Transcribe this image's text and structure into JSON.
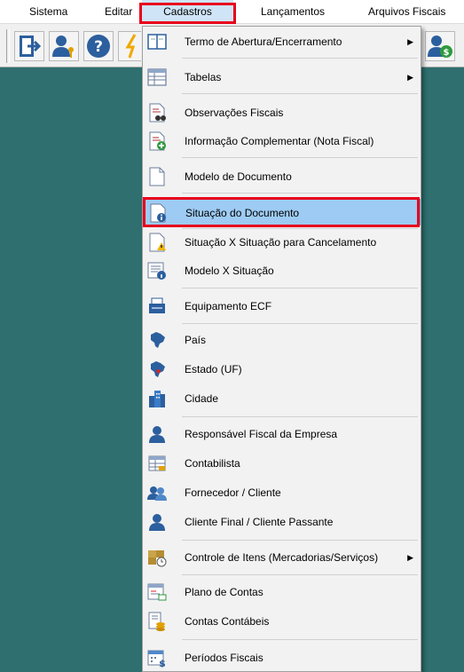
{
  "menubar": {
    "items": [
      {
        "label": "Sistema"
      },
      {
        "label": "Editar"
      },
      {
        "label": "Cadastros"
      },
      {
        "label": "Lançamentos"
      },
      {
        "label": "Arquivos Fiscais"
      }
    ]
  },
  "toolbar": {
    "buttons": [
      {
        "icon": "exit-door-icon"
      },
      {
        "icon": "user-key-icon"
      },
      {
        "icon": "help-icon"
      },
      {
        "icon": "lightning-icon"
      },
      {
        "icon": "user-money-icon"
      }
    ]
  },
  "dropdown": {
    "items": [
      {
        "label": "Termo de Abertura/Encerramento",
        "icon": "book-icon",
        "submenu": true
      },
      {
        "label": "Tabelas",
        "icon": "table-icon",
        "submenu": true
      },
      {
        "label": "Observações Fiscais",
        "icon": "document-binoculars-icon",
        "submenu": false
      },
      {
        "label": "Informação Complementar (Nota Fiscal)",
        "icon": "document-add-icon",
        "submenu": false
      },
      {
        "label": "Modelo de Documento",
        "icon": "blank-document-icon",
        "submenu": false
      },
      {
        "label": "Situação do Documento",
        "icon": "document-info-icon",
        "submenu": false
      },
      {
        "label": "Situação X Situação para Cancelamento",
        "icon": "document-warning-icon",
        "submenu": false
      },
      {
        "label": "Modelo X Situação",
        "icon": "list-info-icon",
        "submenu": false
      },
      {
        "label": "Equipamento ECF",
        "icon": "printer-icon",
        "submenu": false
      },
      {
        "label": "País",
        "icon": "brazil-map-icon",
        "submenu": false
      },
      {
        "label": "Estado (UF)",
        "icon": "brazil-state-map-icon",
        "submenu": false
      },
      {
        "label": "Cidade",
        "icon": "city-buildings-icon",
        "submenu": false
      },
      {
        "label": "Responsável Fiscal da Empresa",
        "icon": "user-icon",
        "submenu": false
      },
      {
        "label": "Contabilista",
        "icon": "ledger-icon",
        "submenu": false
      },
      {
        "label": "Fornecedor / Cliente",
        "icon": "users-icon",
        "submenu": false
      },
      {
        "label": "Cliente Final / Cliente Passante",
        "icon": "user-icon",
        "submenu": false
      },
      {
        "label": "Controle de Itens (Mercadorias/Serviços)",
        "icon": "boxes-clock-icon",
        "submenu": true
      },
      {
        "label": "Plano de Contas",
        "icon": "chart-of-accounts-icon",
        "submenu": false
      },
      {
        "label": "Contas Contábeis",
        "icon": "accounts-coins-icon",
        "submenu": false
      },
      {
        "label": "Períodos Fiscais",
        "icon": "calendar-money-icon",
        "submenu": false
      }
    ],
    "arrow_glyph": "▶"
  },
  "colors": {
    "desktop": "#2f6f6f",
    "highlight_border": "#e8001c",
    "selected_item": "#9dcbf3"
  }
}
